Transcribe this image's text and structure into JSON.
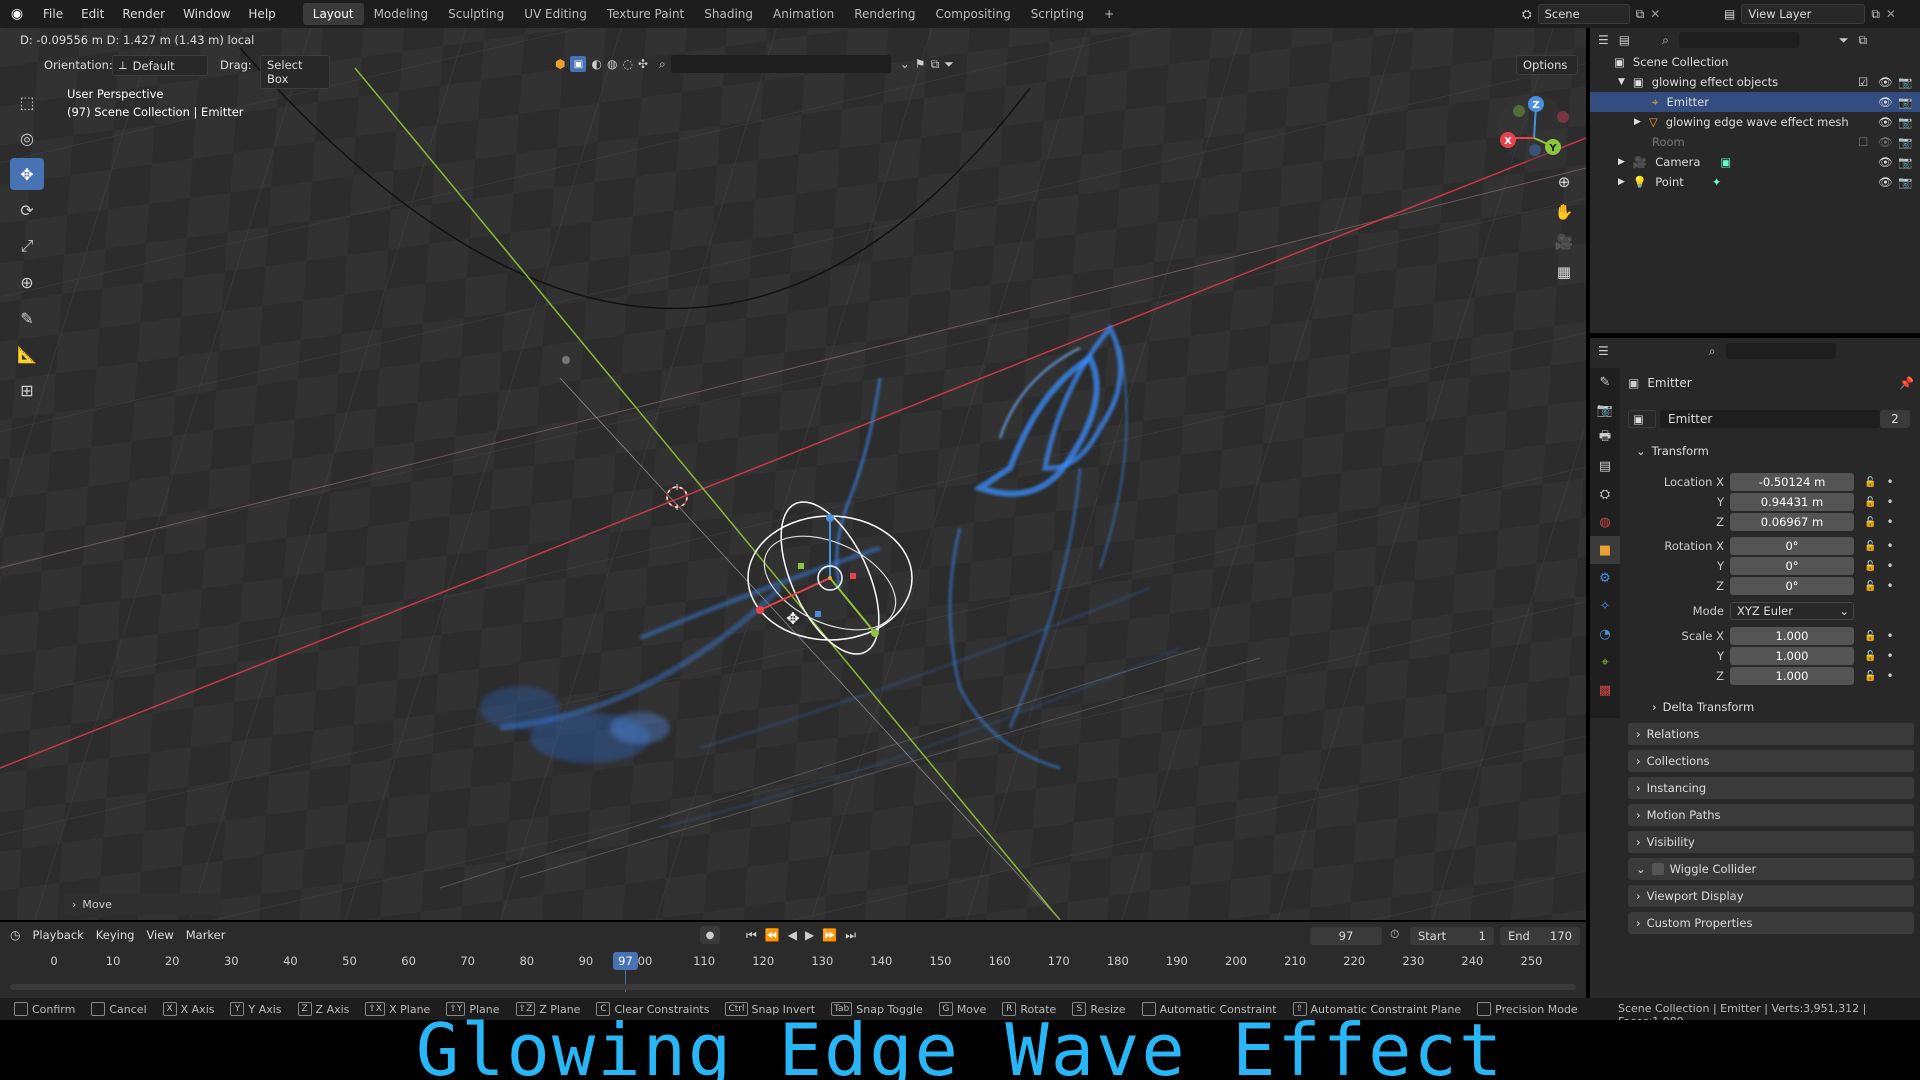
{
  "colors": {
    "accent": "#4772b3",
    "x_axis": "#e8434d",
    "y_axis": "#8cc63f",
    "particles": "#3a8dff",
    "caption": "#29b6f6"
  },
  "topbar": {
    "app_icon": "blender-logo-icon",
    "menus": [
      "File",
      "Edit",
      "Render",
      "Window",
      "Help"
    ],
    "workspaces": [
      "Layout",
      "Modeling",
      "Sculpting",
      "UV Editing",
      "Texture Paint",
      "Shading",
      "Animation",
      "Rendering",
      "Compositing",
      "Scripting"
    ],
    "active_workspace": "Layout",
    "add_label": "+",
    "scene": "Scene",
    "view_layer": "View Layer"
  },
  "viewport": {
    "operator_readout": "D: -0.09556 m  D: 1.427 m (1.43 m) local",
    "orientation_label": "Orientation:",
    "orientation_value": "Default",
    "drag_label": "Drag:",
    "drag_value": "Select Box",
    "options_label": "Options",
    "view_name": "User Perspective",
    "view_context": "(97) Scene Collection | Emitter",
    "last_operator": "Move",
    "gizmo_labels": {
      "z": "Z",
      "y": "Y",
      "x": "X"
    }
  },
  "outliner": {
    "root": "Scene Collection",
    "items": [
      {
        "label": "glowing effect objects",
        "level": 1
      },
      {
        "label": "Emitter",
        "level": 2,
        "selected": true
      },
      {
        "label": "glowing edge wave effect mesh",
        "level": 2
      },
      {
        "label": "Room",
        "level": 1,
        "dim": true
      },
      {
        "label": "Camera",
        "level": 1
      },
      {
        "label": "Point",
        "level": 1
      }
    ]
  },
  "properties": {
    "object_name": "Emitter",
    "datablock_name": "Emitter",
    "user_count": "2",
    "transform_label": "Transform",
    "location_label": "Location X",
    "location": {
      "x": "-0.50124 m",
      "y": "0.94431 m",
      "z": "0.06967 m"
    },
    "rotation_label": "Rotation X",
    "rotation": {
      "x": "0°",
      "y": "0°",
      "z": "0°"
    },
    "mode_label": "Mode",
    "mode_value": "XYZ Euler",
    "scale_label": "Scale X",
    "scale": {
      "x": "1.000",
      "y": "1.000",
      "z": "1.000"
    },
    "axis_y": "Y",
    "axis_z": "Z",
    "delta_transform": "Delta Transform",
    "panels": [
      "Relations",
      "Collections",
      "Instancing",
      "Motion Paths",
      "Visibility",
      "Wiggle Collider",
      "Viewport Display",
      "Custom Properties"
    ]
  },
  "timeline": {
    "menus": [
      "Playback",
      "Keying",
      "View",
      "Marker"
    ],
    "current_frame": "97",
    "start_label": "Start",
    "start": "1",
    "end_label": "End",
    "end": "170",
    "ruler": [
      "0",
      "10",
      "20",
      "30",
      "40",
      "50",
      "60",
      "70",
      "80",
      "90",
      "00",
      "110",
      "120",
      "130",
      "140",
      "150",
      "160",
      "170",
      "180",
      "190",
      "200",
      "210",
      "220",
      "230",
      "240",
      "250"
    ],
    "playhead_label": "97"
  },
  "statusbar": {
    "items": [
      {
        "key": "",
        "label": "Confirm"
      },
      {
        "key": "",
        "label": "Cancel"
      },
      {
        "key": "X",
        "label": "X Axis"
      },
      {
        "key": "Y",
        "label": "Y Axis"
      },
      {
        "key": "Z",
        "label": "Z Axis"
      },
      {
        "key": "⇧X",
        "label": "X Plane"
      },
      {
        "key": "⇧Y",
        "label": "Plane"
      },
      {
        "key": "⇧Z",
        "label": "Z Plane"
      },
      {
        "key": "C",
        "label": "Clear Constraints"
      },
      {
        "key": "Ctrl",
        "label": "Snap Invert"
      },
      {
        "key": "Tab",
        "label": "Snap Toggle"
      },
      {
        "key": "G",
        "label": "Move"
      },
      {
        "key": "R",
        "label": "Rotate"
      },
      {
        "key": "S",
        "label": "Resize"
      },
      {
        "key": "",
        "label": "Automatic Constraint"
      },
      {
        "key": "⇧",
        "label": "Automatic Constraint Plane"
      },
      {
        "key": "",
        "label": "Precision Mode"
      }
    ],
    "stats": "Scene Collection | Emitter | Verts:3,951,312 | Faces:1,989,"
  },
  "caption": "Glowing Edge Wave Effect"
}
